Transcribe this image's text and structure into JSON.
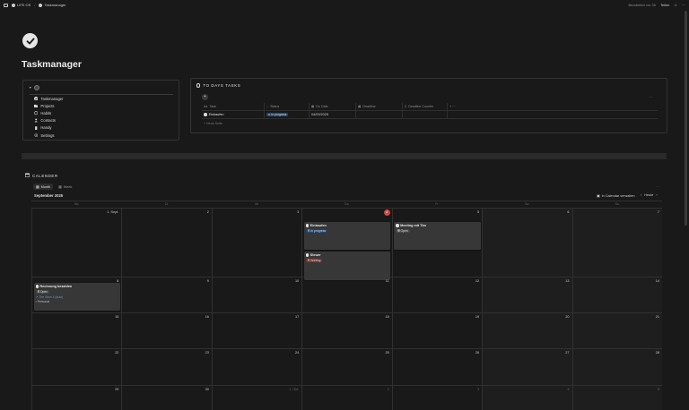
{
  "topbar": {
    "breadcrumb": [
      "LIFE OS",
      "Taskmanager"
    ],
    "edited": "Bearbeitet vor 3h",
    "share": "Teilen"
  },
  "page": {
    "title": "Taskmanager"
  },
  "nav": {
    "items": [
      {
        "label": "Taskmanager",
        "icon": "check-circle-icon"
      },
      {
        "label": "Projects",
        "icon": "folder-icon"
      },
      {
        "label": "Habits",
        "icon": "circle-icon"
      },
      {
        "label": "Contacts",
        "icon": "contacts-icon"
      },
      {
        "label": "Handy",
        "icon": "phone-icon"
      },
      {
        "label": "Settings",
        "icon": "gear-icon"
      }
    ]
  },
  "todays": {
    "title": "TO DAYS TASKS",
    "columns": [
      "Task",
      "Status",
      "Do Date",
      "Deadline",
      "Deadline Counter"
    ],
    "rows": [
      {
        "task": "Einkaufen",
        "status": "In progress",
        "do_date": "04/09/2025",
        "deadline": "",
        "counter": ""
      }
    ],
    "new_label": "Neue Seite"
  },
  "calendar": {
    "title": "CALENDER",
    "tabs": [
      {
        "label": "Month",
        "active": true
      },
      {
        "label": "Week",
        "active": false
      }
    ],
    "month_label": "September 2025",
    "open_label": "In Calendar verwalten",
    "today_label": "Heute",
    "weekdays": [
      "Mo",
      "Di",
      "Mi",
      "Do",
      "Fr",
      "Sa",
      "So"
    ],
    "weeks": [
      [
        "1. Sept.",
        "2",
        "3",
        "4",
        "5",
        "6",
        "7"
      ],
      [
        "8",
        "9",
        "10",
        "11",
        "12",
        "13",
        "14"
      ],
      [
        "15",
        "16",
        "17",
        "18",
        "19",
        "20",
        "21"
      ],
      [
        "22",
        "23",
        "24",
        "25",
        "26",
        "27",
        "28"
      ],
      [
        "29",
        "30",
        "1. Okt.",
        "2",
        "3",
        "4",
        "5"
      ]
    ],
    "today": "4",
    "events": {
      "einkaufen": {
        "title": "Einkaufen",
        "status": "In progress"
      },
      "steuer": {
        "title": "Steuer",
        "status": "Waiting"
      },
      "meeting": {
        "title": "Meeting mit Tim",
        "status": "Open"
      },
      "rechnung": {
        "title": "Rechnung bezahlen",
        "status": "Open",
        "link": "The Sims 4 (auto)",
        "area": "Personal"
      }
    }
  },
  "colors": {
    "background": "#191919",
    "today_marker": "#d4473c",
    "tag_blue": "#28456c",
    "tag_red": "#6e3630",
    "tag_gray": "#474747"
  }
}
